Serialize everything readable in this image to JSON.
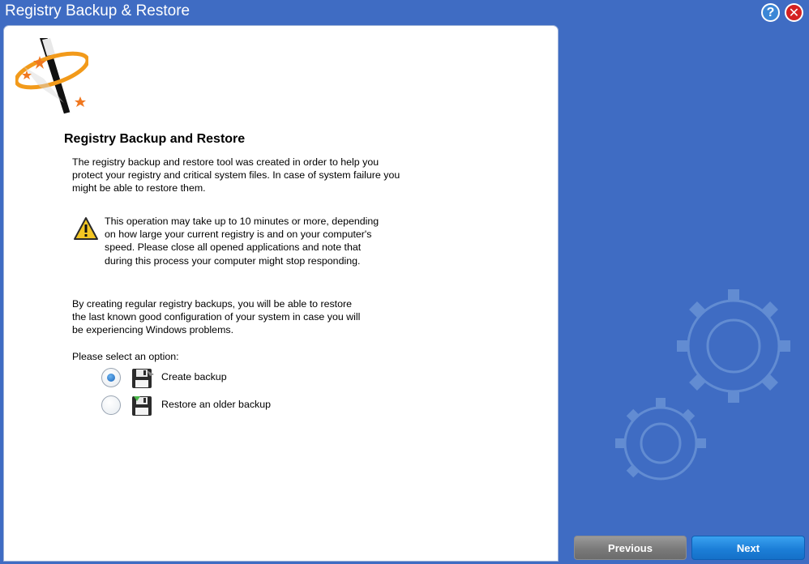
{
  "window": {
    "title": "Registry Backup & Restore",
    "help_button": "?",
    "close_button": "✕"
  },
  "content": {
    "heading": "Registry Backup and Restore",
    "intro": "The registry backup and restore tool was created in order to help you protect your registry and critical system files. In case of system failure you might be able to restore them.",
    "warning": "This operation may take up to 10 minutes or more, depending on how large your current registry is and on your computer's speed. Please close all opened applications and note that during this process your computer might stop responding.",
    "regular_backups": "By creating regular registry backups, you will be able to restore the last known good configuration of your system in case you will be experiencing Windows problems.",
    "select_prompt": "Please select an option:",
    "options": [
      {
        "label": "Create backup",
        "selected": true,
        "icon": "floppy-disk-save-icon"
      },
      {
        "label": "Restore an older backup",
        "selected": false,
        "icon": "floppy-disk-restore-icon"
      }
    ]
  },
  "footer": {
    "previous_label": "Previous",
    "next_label": "Next"
  },
  "colors": {
    "background": "#3f6cc3",
    "next_button": "#1c7fd8",
    "previous_button": "#7a7a7a",
    "close_button": "#d42121"
  }
}
